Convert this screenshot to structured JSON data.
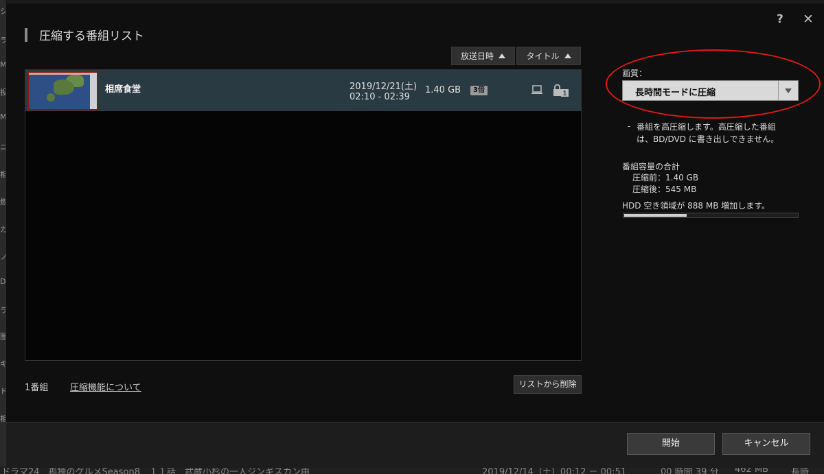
{
  "background": {
    "left_glyphs": [
      "シ",
      "ラ",
      "M",
      "投",
      "M",
      "ニ",
      "相",
      "燃",
      "ガ",
      "ノ",
      "D",
      "ラ",
      "圏",
      "キ",
      "ド",
      "相"
    ],
    "bottom_row": {
      "title": "ドラマ24　孤独のグルメSeason8　１１話　武蔵小杉の一人ジンギスカン由",
      "date": "2019/12/14（土）00:12 － 00:51",
      "duration": "00 時間 39 分",
      "size": "462 MB",
      "extra": "長時"
    }
  },
  "dialog": {
    "title": "圧縮する番組リスト",
    "help_label": "?",
    "close_label": "✕",
    "sort_buttons": [
      {
        "label": "放送日時"
      },
      {
        "label": "タイトル"
      }
    ],
    "programs": [
      {
        "title": "相席食堂",
        "date": "2019/12/21(土)",
        "time": "02:10 - 02:39",
        "size": "1.40 GB",
        "badge": "3倍",
        "lock_count": "1"
      }
    ],
    "count_label": "1番組",
    "about_link": "圧縮機能について",
    "remove_button": "リストから削除"
  },
  "settings": {
    "quality_label": "画質：",
    "quality_value": "長時間モードに圧縮",
    "description_dash": "-",
    "description_line1": "番組を高圧縮します。高圧縮した番組",
    "description_line2": "は、BD/DVD に書き出しできません。",
    "total_heading": "番組容量の合計",
    "before_label": "圧縮前：1.40 GB",
    "after_label": "圧縮後：545 MB",
    "increase_label": "HDD 空き領域が 888 MB 増加します。",
    "free_space_fraction": 0.36
  },
  "footer": {
    "start_button": "開始",
    "cancel_button": "キャンセル"
  },
  "colors": {
    "row_highlight": "#2a3a42",
    "annotation_red": "#e01818"
  }
}
